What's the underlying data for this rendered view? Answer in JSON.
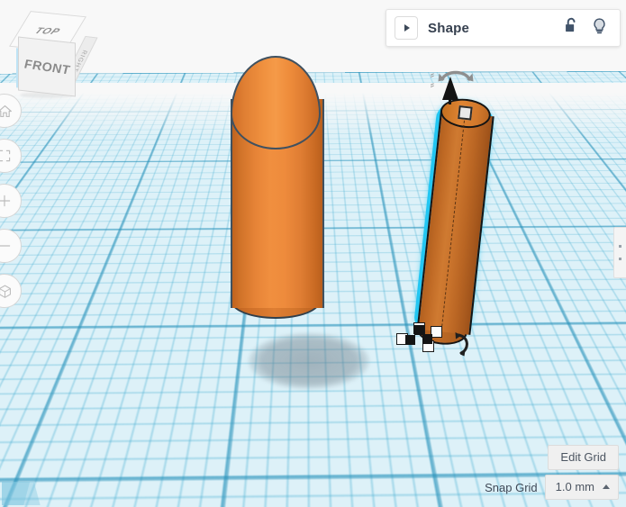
{
  "app": {
    "background_color": "#f8f8f8",
    "workplane_color": "#ddf1f8",
    "grid_line_color": "#2991b9",
    "selection_color": "#22c6f2",
    "shape_color": "#ee8b3c",
    "shape_outline_color": "#3f5160"
  },
  "view_cube": {
    "top_label": "TOP",
    "front_label": "FRONT",
    "right_label": "RIGHT",
    "highlight_color": "#bfe3f5"
  },
  "left_toolbar": {
    "items": [
      {
        "name": "home-view-button",
        "icon": "home-icon",
        "label": "Home view"
      },
      {
        "name": "fit-view-button",
        "icon": "fit-to-view-icon",
        "label": "Fit view"
      },
      {
        "name": "zoom-in-button",
        "icon": "plus-icon",
        "label": "Zoom in"
      },
      {
        "name": "zoom-out-button",
        "icon": "minus-icon",
        "label": "Zoom out"
      },
      {
        "name": "perspective-toggle-button",
        "icon": "cube-icon",
        "label": "Switch to orthographic view"
      }
    ]
  },
  "shape_panel": {
    "expand_icon": "triangle-right-icon",
    "title": "Shape",
    "lock_icon": "unlocked-padlock-icon",
    "light_icon": "lightbulb-icon",
    "lock_state": "unlocked"
  },
  "viewport": {
    "objects": [
      {
        "name": "cylinder-large",
        "type": "cylinder",
        "selected": false,
        "color": "#ee8b3c",
        "has_shadow": true
      },
      {
        "name": "cylinder-selected",
        "type": "cylinder",
        "selected": true,
        "color": "#c8722b",
        "rotation_deg": 6.2,
        "has_shadow": false
      }
    ],
    "gizmo": {
      "height_handle": "cone-arrow-up-icon",
      "rotate_handle_top": "rotate-arrow-icon",
      "rotate_handle_bottom": "rotate-arrow-icon",
      "top_scale_handle": "square-handle",
      "corner_handles": 3,
      "edge_handles": 3
    }
  },
  "bottom_controls": {
    "edit_grid_label": "Edit Grid",
    "snap_grid_label": "Snap Grid",
    "snap_grid_value": "1.0 mm",
    "snap_grid_caret": "caret-up-icon"
  },
  "right_panel_tab": {
    "name": "collapsed-panel-tab",
    "dots": 2
  }
}
